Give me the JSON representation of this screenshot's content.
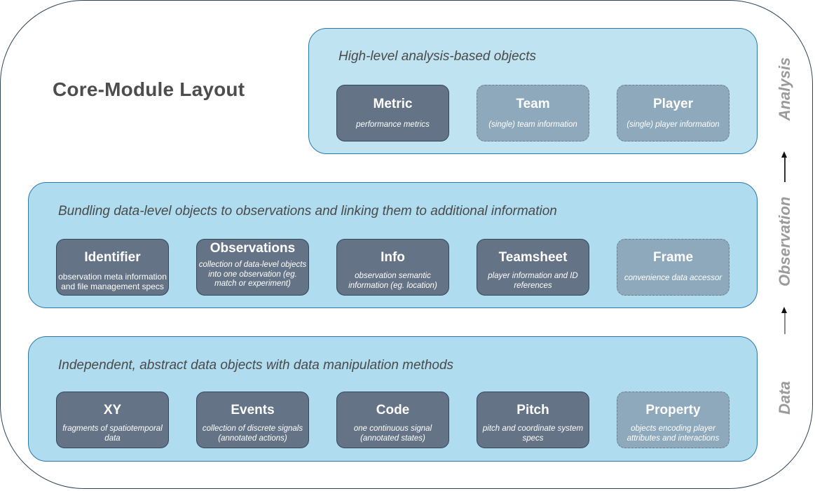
{
  "title": "Core-Module Layout",
  "side_labels": [
    "Analysis",
    "Observation",
    "Data"
  ],
  "layers": {
    "analysis": {
      "description": "High-level analysis-based objects",
      "boxes": [
        {
          "name": "Metric",
          "desc": "performance metrics",
          "style": "solid"
        },
        {
          "name": "Team",
          "desc": "(single) team information",
          "style": "dashed"
        },
        {
          "name": "Player",
          "desc": "(single) player information",
          "style": "dashed"
        }
      ]
    },
    "observation": {
      "description": "Bundling data-level objects to observations and linking them to additional information",
      "boxes": [
        {
          "name": "Identifier",
          "desc": "observation meta information and file management specs",
          "style": "solid"
        },
        {
          "name": "Observations",
          "desc": "collection of data-level objects into one observation (eg. match or experiment)",
          "style": "solid"
        },
        {
          "name": "Info",
          "desc": "observation semantic information (eg. location)",
          "style": "solid"
        },
        {
          "name": "Teamsheet",
          "desc": "player information and ID references",
          "style": "solid"
        },
        {
          "name": "Frame",
          "desc": "convenience data accessor",
          "style": "dashed"
        }
      ]
    },
    "data": {
      "description": "Independent, abstract data objects with data manipulation methods",
      "boxes": [
        {
          "name": "XY",
          "desc": "fragments of spatiotemporal data",
          "style": "solid"
        },
        {
          "name": "Events",
          "desc": "collection of discrete signals (annotated actions)",
          "style": "solid"
        },
        {
          "name": "Code",
          "desc": "one continuous signal (annotated states)",
          "style": "solid"
        },
        {
          "name": "Pitch",
          "desc": "pitch and coordinate system specs",
          "style": "solid"
        },
        {
          "name": "Property",
          "desc": "objects encoding player attributes and interactions",
          "style": "dashed"
        }
      ]
    }
  },
  "colors": {
    "solid_box": "#647386",
    "dashed_box": "#8da9bb",
    "layer_fill": "#b0dcef",
    "layer_border": "#2a79a8",
    "side_label": "#9a9a9a"
  }
}
